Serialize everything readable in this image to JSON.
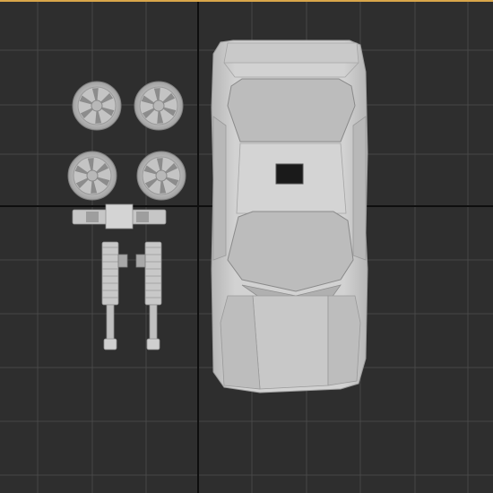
{
  "viewport": {
    "view": "top",
    "objects": [
      "car-body",
      "wheel",
      "wheel",
      "wheel",
      "wheel",
      "axle-part",
      "suspension-arm",
      "suspension-arm"
    ]
  },
  "colors": {
    "background": "#2e2e2e",
    "grid_line": "#474747",
    "grid_axis": "#0e0e0e",
    "active_border": "#d9a64a",
    "model_light": "#d6d6d6",
    "model_mid": "#bdbdbd",
    "model_dark": "#8a8a8a",
    "window": "#b8b8b8",
    "sunroof": "#1a1a1a"
  }
}
